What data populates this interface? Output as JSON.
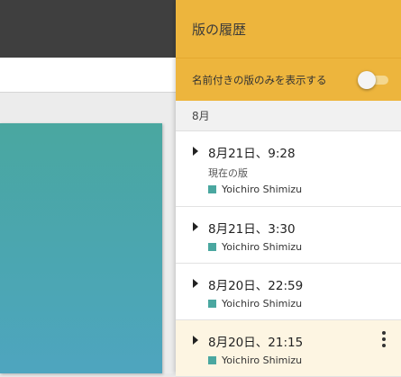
{
  "panel": {
    "title": "版の履歴",
    "filter_label": "名前付きの版のみを表示する",
    "filter_enabled": false
  },
  "month": "8月",
  "versions": [
    {
      "date": "8月21日、9:28",
      "label": "現在の版",
      "author": "Yoichiro Shimizu"
    },
    {
      "date": "8月21日、3:30",
      "author": "Yoichiro Shimizu"
    },
    {
      "date": "8月20日、22:59",
      "author": "Yoichiro Shimizu"
    },
    {
      "date": "8月20日、21:15",
      "author": "Yoichiro Shimizu",
      "selected": true
    }
  ],
  "colors": {
    "accent": "#edb53d",
    "author": "#4aa7a0",
    "topbar": "#3f3f3f",
    "slide": "#4ba6b1"
  },
  "icons": {
    "expand": "triangle-right-icon",
    "more": "more-vertical-icon"
  }
}
